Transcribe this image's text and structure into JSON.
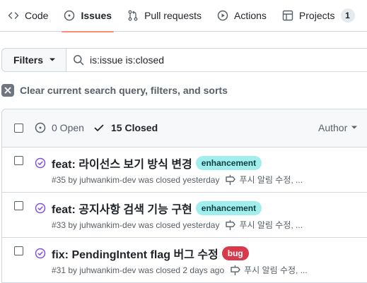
{
  "nav": {
    "tabs": [
      {
        "label": "Code",
        "icon": "code-icon"
      },
      {
        "label": "Issues",
        "icon": "issue-opened-icon",
        "selected": true
      },
      {
        "label": "Pull requests",
        "icon": "git-pull-request-icon"
      },
      {
        "label": "Actions",
        "icon": "play-icon"
      },
      {
        "label": "Projects",
        "icon": "table-icon",
        "counter": "1"
      }
    ],
    "selected_underline_color": "#fd8c73"
  },
  "filter_bar": {
    "filters_label": "Filters",
    "search_value": "is:issue is:closed"
  },
  "clear_query": {
    "label": "Clear current search query, filters, and sorts"
  },
  "issues_header": {
    "open_label": "0 Open",
    "closed_label": "15 Closed",
    "author_label": "Author"
  },
  "issues": [
    {
      "title": "feat: 라이선스 보기 방식 변경",
      "label": {
        "text": "enhancement",
        "bg": "#a2eeef",
        "fg": "#0b3f40"
      },
      "meta": "#35 by juhwankim-dev was closed yesterday",
      "milestone": "푸시 알림 수정, ..."
    },
    {
      "title": "feat: 공지사항 검색 기능 구현",
      "label": {
        "text": "enhancement",
        "bg": "#a2eeef",
        "fg": "#0b3f40"
      },
      "meta": "#33 by juhwankim-dev was closed yesterday",
      "milestone": "푸시 알림 수정, ..."
    },
    {
      "title": "fix: PendingIntent flag 버그 수정",
      "label": {
        "text": "bug",
        "bg": "#d73a4a",
        "fg": "#ffffff"
      },
      "meta": "#31 by juhwankim-dev was closed 2 days ago",
      "milestone": "푸시 알림 수정, ..."
    }
  ],
  "colors": {
    "closed_icon": "#8250df",
    "border": "#d0d7de",
    "muted_text": "#57606a"
  }
}
